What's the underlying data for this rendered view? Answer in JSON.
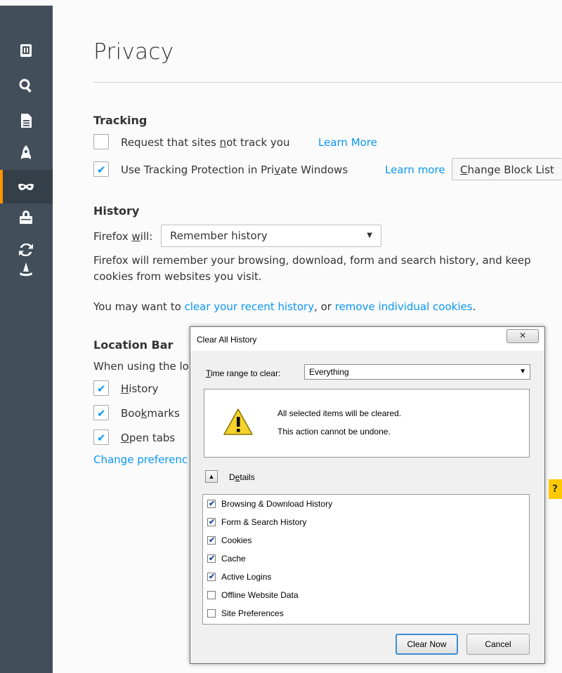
{
  "sidebar": {
    "items": [
      {
        "name": "general"
      },
      {
        "name": "search"
      },
      {
        "name": "content"
      },
      {
        "name": "applications"
      },
      {
        "name": "privacy",
        "selected": true
      },
      {
        "name": "security"
      },
      {
        "name": "sync"
      },
      {
        "name": "advanced"
      }
    ]
  },
  "main": {
    "page_title": "Privacy",
    "tracking": {
      "heading": "Tracking",
      "dnt_label_pre": "Request that sites ",
      "dnt_label_u": "n",
      "dnt_label_post": "ot track you",
      "dnt_checked": false,
      "dnt_learn_more": "Learn More",
      "tp_label_pre": "Use Tracking Protection in Pri",
      "tp_label_u": "v",
      "tp_label_post": "ate Windows",
      "tp_checked": true,
      "tp_learn_more": "Learn more",
      "change_block_list_u": "C",
      "change_block_list_rest": "hange Block List"
    },
    "history": {
      "heading": "History",
      "firefox_will_pre": "Firefox ",
      "firefox_will_u": "w",
      "firefox_will_post": "ill:",
      "select_value": "Remember history",
      "description": "Firefox will remember your browsing, download, form and search history, and keep",
      "description_line2": "cookies from websites you visit.",
      "may_want_pre": "You may want to ",
      "clear_recent_link": "clear your recent history",
      "may_want_mid": ", or ",
      "remove_cookies_link": "remove individual cookies",
      "may_want_post": "."
    },
    "location_bar": {
      "heading": "Location Bar",
      "intro": "When using the lo",
      "options": [
        {
          "u": "H",
          "rest": "istory",
          "checked": true
        },
        {
          "pre": "Boo",
          "u": "k",
          "rest": "marks",
          "checked": true
        },
        {
          "u": "O",
          "rest": "pen tabs",
          "checked": true
        }
      ],
      "change_prefs_link": "Change preferenc"
    },
    "help_button": "?"
  },
  "dialog": {
    "title": "Clear All History",
    "close_glyph": "✕",
    "time_range_u": "T",
    "time_range_rest": "ime range to clear:",
    "time_range_value": "Everything",
    "warning_line1": "All selected items will be cleared.",
    "warning_line2": "This action cannot be undone.",
    "details_u": "e",
    "details_pre": "D",
    "details_post": "tails",
    "items": [
      {
        "label": "Browsing & Download History",
        "checked": true
      },
      {
        "label": "Form & Search History",
        "checked": true
      },
      {
        "label": "Cookies",
        "checked": true
      },
      {
        "label": "Cache",
        "checked": true
      },
      {
        "label": "Active Logins",
        "checked": true
      },
      {
        "label": "Offline Website Data",
        "checked": false
      },
      {
        "label": "Site Preferences",
        "checked": false
      }
    ],
    "clear_now": "Clear Now",
    "cancel": "Cancel"
  },
  "colors": {
    "sidebar_bg": "#424f5a",
    "accent_link": "#0996f8",
    "selected_marker": "#ff9500",
    "help_button": "#ffcb00"
  }
}
